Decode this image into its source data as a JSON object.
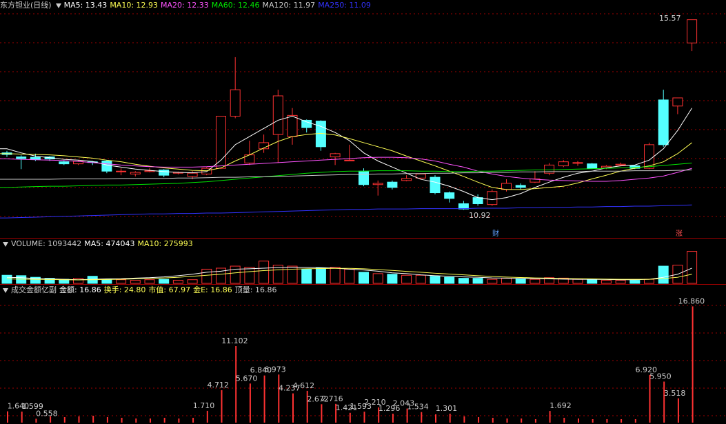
{
  "price_header": {
    "title": "东方钽业(日线)",
    "ma5": "MA5: 13.43",
    "ma10": "MA10: 12.93",
    "ma20": "MA20: 12.33",
    "ma60": "MA60: 12.46",
    "ma120": "MA120: 11.97",
    "ma250": "MA250: 11.09"
  },
  "price_annotations": {
    "high_label": "15.57",
    "low_label": "10.92",
    "marker_cai": "财",
    "marker_zhang": "涨"
  },
  "volume_header": {
    "volume": "VOLUME: 1093442",
    "ma5": "MA5: 474043",
    "ma10": "MA10: 275993"
  },
  "amount_header": {
    "title": "成交金额亿副",
    "amount": "金额: 16.86",
    "turnover": "换手: 24.80",
    "mktcap": "市值: 67.97",
    "gold": "金E: 16.86",
    "peak": "顶量: 16.86"
  },
  "colors": {
    "up": "#ff3232",
    "down": "#54ffff",
    "ma5": "#ffffff",
    "ma10": "#ffff54",
    "ma20": "#ff54ff",
    "ma60": "#00e600",
    "ma120": "#cccccc",
    "ma250": "#3232ff",
    "grid": "#a00000"
  },
  "chart_data": {
    "type": "candlestick",
    "candles": [
      {
        "o": 12.3,
        "c": 12.26,
        "h": 12.35,
        "l": 12.2
      },
      {
        "o": 12.2,
        "c": 12.16,
        "h": 12.24,
        "l": 11.9
      },
      {
        "o": 12.19,
        "c": 12.14,
        "h": 12.28,
        "l": 12.1
      },
      {
        "o": 12.2,
        "c": 12.15,
        "h": 12.22,
        "l": 12.1
      },
      {
        "o": 12.08,
        "c": 12.03,
        "h": 12.12,
        "l": 12.0
      },
      {
        "o": 12.03,
        "c": 12.09,
        "h": 12.12,
        "l": 12.0
      },
      {
        "o": 12.08,
        "c": 12.07,
        "h": 12.1,
        "l": 12.0
      },
      {
        "o": 12.1,
        "c": 11.85,
        "h": 12.12,
        "l": 11.8
      },
      {
        "o": 11.85,
        "c": 11.85,
        "h": 11.92,
        "l": 11.75
      },
      {
        "o": 11.78,
        "c": 11.82,
        "h": 11.85,
        "l": 11.72
      },
      {
        "o": 11.84,
        "c": 11.86,
        "h": 11.92,
        "l": 11.82
      },
      {
        "o": 11.88,
        "c": 11.75,
        "h": 11.9,
        "l": 11.7
      },
      {
        "o": 11.8,
        "c": 11.82,
        "h": 11.84,
        "l": 11.77
      },
      {
        "o": 11.72,
        "c": 11.8,
        "h": 11.85,
        "l": 11.65
      },
      {
        "o": 11.78,
        "c": 11.92,
        "h": 11.95,
        "l": 11.75
      },
      {
        "o": 11.92,
        "c": 13.2,
        "h": 13.2,
        "l": 11.9
      },
      {
        "o": 13.2,
        "c": 13.85,
        "h": 14.65,
        "l": 13.15
      },
      {
        "o": 12.05,
        "c": 12.25,
        "h": 12.6,
        "l": 12.0
      },
      {
        "o": 12.4,
        "c": 12.55,
        "h": 12.75,
        "l": 12.3
      },
      {
        "o": 12.75,
        "c": 13.7,
        "h": 13.85,
        "l": 12.05
      },
      {
        "o": 12.7,
        "c": 13.22,
        "h": 13.4,
        "l": 12.5
      },
      {
        "o": 13.1,
        "c": 12.92,
        "h": 13.12,
        "l": 12.8
      },
      {
        "o": 13.08,
        "c": 12.45,
        "h": 13.1,
        "l": 12.35
      },
      {
        "o": 12.2,
        "c": 12.28,
        "h": 12.3,
        "l": 12.0
      },
      {
        "o": 12.12,
        "c": 12.12,
        "h": 12.5,
        "l": 12.1
      },
      {
        "o": 11.85,
        "c": 11.52,
        "h": 11.92,
        "l": 11.48
      },
      {
        "o": 11.52,
        "c": 11.55,
        "h": 11.62,
        "l": 11.25
      },
      {
        "o": 11.58,
        "c": 11.45,
        "h": 11.62,
        "l": 11.4
      },
      {
        "o": 11.62,
        "c": 11.67,
        "h": 11.75,
        "l": 11.6
      },
      {
        "o": 11.68,
        "c": 11.78,
        "h": 11.8,
        "l": 11.65
      },
      {
        "o": 11.7,
        "c": 11.32,
        "h": 11.75,
        "l": 11.28
      },
      {
        "o": 11.32,
        "c": 11.18,
        "h": 11.35,
        "l": 11.08
      },
      {
        "o": 11.05,
        "c": 10.92,
        "h": 11.12,
        "l": 10.9
      },
      {
        "o": 11.2,
        "c": 11.05,
        "h": 11.28,
        "l": 11.0
      },
      {
        "o": 11.03,
        "c": 11.35,
        "h": 11.4,
        "l": 11.0
      },
      {
        "o": 11.4,
        "c": 11.55,
        "h": 11.65,
        "l": 11.35
      },
      {
        "o": 11.5,
        "c": 11.45,
        "h": 11.55,
        "l": 11.4
      },
      {
        "o": 11.58,
        "c": 11.66,
        "h": 11.85,
        "l": 11.56
      },
      {
        "o": 11.8,
        "c": 12.0,
        "h": 12.05,
        "l": 11.75
      },
      {
        "o": 11.98,
        "c": 12.08,
        "h": 12.12,
        "l": 11.95
      },
      {
        "o": 12.05,
        "c": 12.06,
        "h": 12.1,
        "l": 11.98
      },
      {
        "o": 12.03,
        "c": 11.92,
        "h": 12.05,
        "l": 11.9
      },
      {
        "o": 11.93,
        "c": 11.97,
        "h": 12.0,
        "l": 11.9
      },
      {
        "o": 12.0,
        "c": 12.02,
        "h": 12.06,
        "l": 11.97
      },
      {
        "o": 11.98,
        "c": 11.92,
        "h": 12.0,
        "l": 11.9
      },
      {
        "o": 11.92,
        "c": 12.5,
        "h": 12.55,
        "l": 11.9
      },
      {
        "o": 13.6,
        "c": 12.5,
        "h": 13.85,
        "l": 12.45
      },
      {
        "o": 13.45,
        "c": 13.65,
        "h": 13.65,
        "l": 13.25
      },
      {
        "o": 15.0,
        "c": 15.57,
        "h": 15.57,
        "l": 14.8
      }
    ],
    "ma": {
      "ma5": [
        12.4,
        12.3,
        12.22,
        12.18,
        12.14,
        12.12,
        12.09,
        12.0,
        11.95,
        11.9,
        11.87,
        11.84,
        11.82,
        11.81,
        11.84,
        12.12,
        12.5,
        12.7,
        12.9,
        13.1,
        13.2,
        13.06,
        12.95,
        12.8,
        12.6,
        12.3,
        12.1,
        11.95,
        11.8,
        11.65,
        11.58,
        11.48,
        11.35,
        11.2,
        11.15,
        11.2,
        11.3,
        11.45,
        11.58,
        11.7,
        11.8,
        11.85,
        11.93,
        11.98,
        12.0,
        12.12,
        12.4,
        12.85,
        13.4
      ],
      "ma10": [
        12.28,
        12.27,
        12.26,
        12.25,
        12.23,
        12.2,
        12.17,
        12.12,
        12.08,
        12.02,
        11.97,
        11.93,
        11.9,
        11.87,
        11.86,
        11.93,
        12.1,
        12.25,
        12.42,
        12.58,
        12.7,
        12.75,
        12.78,
        12.74,
        12.65,
        12.55,
        12.45,
        12.35,
        12.22,
        12.1,
        11.98,
        11.85,
        11.72,
        11.58,
        11.45,
        11.4,
        11.4,
        11.42,
        11.45,
        11.48,
        11.56,
        11.66,
        11.75,
        11.85,
        11.92,
        11.98,
        12.08,
        12.28,
        12.55
      ],
      "ma20": [
        12.15,
        12.14,
        12.13,
        12.12,
        12.11,
        12.09,
        12.06,
        12.03,
        12.0,
        11.98,
        11.96,
        11.95,
        11.95,
        11.95,
        11.96,
        11.98,
        12.0,
        12.02,
        12.04,
        12.06,
        12.08,
        12.1,
        12.12,
        12.14,
        12.16,
        12.18,
        12.19,
        12.19,
        12.18,
        12.15,
        12.1,
        12.02,
        11.95,
        11.85,
        11.78,
        11.72,
        11.68,
        11.65,
        11.63,
        11.62,
        11.61,
        11.6,
        11.6,
        11.62,
        11.65,
        11.68,
        11.73,
        11.82,
        11.92
      ],
      "ma60": [
        11.45,
        11.46,
        11.47,
        11.48,
        11.48,
        11.49,
        11.5,
        11.51,
        11.51,
        11.52,
        11.53,
        11.54,
        11.55,
        11.57,
        11.59,
        11.62,
        11.65,
        11.68,
        11.71,
        11.74,
        11.77,
        11.8,
        11.82,
        11.84,
        11.85,
        11.85,
        11.86,
        11.86,
        11.86,
        11.85,
        11.85,
        11.84,
        11.84,
        11.85,
        11.85,
        11.86,
        11.87,
        11.88,
        11.88,
        11.89,
        11.9,
        11.91,
        11.92,
        11.93,
        11.94,
        11.96,
        11.99,
        12.02,
        12.05
      ],
      "ma120": [
        11.65,
        11.65,
        11.65,
        11.65,
        11.66,
        11.66,
        11.66,
        11.66,
        11.67,
        11.67,
        11.67,
        11.67,
        11.68,
        11.68,
        11.69,
        11.7,
        11.7,
        11.71,
        11.71,
        11.72,
        11.73,
        11.74,
        11.75,
        11.76,
        11.77,
        11.77,
        11.78,
        11.78,
        11.79,
        11.79,
        11.8,
        11.8,
        11.81,
        11.81,
        11.82,
        11.82,
        11.83,
        11.83,
        11.84,
        11.84,
        11.84,
        11.85,
        11.85,
        11.85,
        11.86,
        11.86,
        11.86,
        11.87,
        11.88
      ],
      "ma250": [
        10.7,
        10.71,
        10.72,
        10.73,
        10.74,
        10.75,
        10.76,
        10.77,
        10.78,
        10.79,
        10.8,
        10.8,
        10.81,
        10.81,
        10.82,
        10.82,
        10.83,
        10.84,
        10.85,
        10.86,
        10.87,
        10.88,
        10.89,
        10.9,
        10.91,
        10.91,
        10.92,
        10.92,
        10.92,
        10.93,
        10.93,
        10.93,
        10.93,
        10.94,
        10.94,
        10.94,
        10.95,
        10.95,
        10.96,
        10.96,
        10.97,
        10.97,
        10.98,
        10.98,
        10.99,
        10.99,
        11.0,
        11.01,
        11.02
      ]
    },
    "price_range": [
      10.55,
      15.75
    ],
    "volume": [
      40,
      38,
      30,
      25,
      20,
      25,
      35,
      20,
      18,
      15,
      18,
      20,
      15,
      18,
      70,
      75,
      85,
      80,
      110,
      90,
      85,
      70,
      75,
      80,
      70,
      55,
      48,
      45,
      40,
      40,
      35,
      30,
      25,
      25,
      20,
      25,
      22,
      20,
      28,
      26,
      20,
      18,
      15,
      15,
      15,
      20,
      85,
      90,
      158
    ],
    "volume_ma5": [
      30,
      28,
      24,
      22,
      20,
      18,
      20,
      22,
      23,
      26,
      28,
      32,
      38,
      45,
      55,
      60,
      70,
      72,
      75,
      78,
      80,
      80,
      78,
      75,
      70,
      66,
      60,
      52,
      48,
      42,
      38,
      35,
      32,
      30,
      27,
      26,
      24,
      23,
      22,
      21,
      20,
      20,
      19,
      18,
      18,
      20,
      30,
      45,
      75
    ],
    "volume_ma10": [
      22,
      21,
      20,
      19,
      18,
      17,
      18,
      19,
      20,
      22,
      24,
      27,
      30,
      35,
      40,
      45,
      52,
      58,
      63,
      67,
      70,
      72,
      73,
      74,
      74,
      72,
      68,
      64,
      59,
      55,
      50,
      46,
      42,
      38,
      34,
      31,
      29,
      27,
      26,
      24,
      23,
      22,
      21,
      20,
      20,
      20,
      24,
      30,
      45
    ],
    "volume_range": [
      0,
      160
    ],
    "amount_labels": [
      {
        "i": 1,
        "v": "1.640"
      },
      {
        "i": 2,
        "v": "1.599"
      },
      {
        "i": 3,
        "v": "0.558"
      },
      {
        "i": 14,
        "v": "1.710"
      },
      {
        "i": 15,
        "v": "4.712"
      },
      {
        "i": 16,
        "v": "11.102"
      },
      {
        "i": 17,
        "v": "5.670"
      },
      {
        "i": 18,
        "v": "6.840"
      },
      {
        "i": 19,
        "v": "6.973"
      },
      {
        "i": 20,
        "v": "4.237"
      },
      {
        "i": 21,
        "v": "4.612"
      },
      {
        "i": 22,
        "v": "2.672"
      },
      {
        "i": 23,
        "v": "2.716"
      },
      {
        "i": 24,
        "v": "1.421"
      },
      {
        "i": 25,
        "v": "1.593"
      },
      {
        "i": 26,
        "v": "2.210"
      },
      {
        "i": 27,
        "v": "1.296"
      },
      {
        "i": 28,
        "v": "2.043"
      },
      {
        "i": 29,
        "v": "1.534"
      },
      {
        "i": 31,
        "v": "1.301"
      },
      {
        "i": 39,
        "v": "1.692"
      },
      {
        "i": 45,
        "v": "6.920"
      },
      {
        "i": 46,
        "v": "5.950"
      },
      {
        "i": 47,
        "v": "3.518"
      },
      {
        "i": 48,
        "v": "16.860"
      }
    ],
    "amount": [
      1.64,
      1.6,
      0.56,
      0.9,
      0.8,
      0.9,
      1.0,
      0.8,
      0.7,
      0.6,
      0.6,
      0.7,
      0.6,
      0.7,
      1.71,
      4.71,
      11.1,
      5.67,
      6.84,
      6.97,
      4.24,
      4.61,
      2.67,
      2.72,
      1.42,
      1.59,
      2.21,
      1.3,
      2.04,
      1.53,
      1.2,
      1.3,
      0.9,
      0.8,
      0.7,
      0.6,
      0.6,
      0.5,
      1.69,
      0.7,
      0.6,
      0.5,
      0.5,
      0.5,
      0.5,
      6.92,
      5.95,
      3.52,
      16.86
    ],
    "amount_range": [
      0,
      18
    ]
  }
}
